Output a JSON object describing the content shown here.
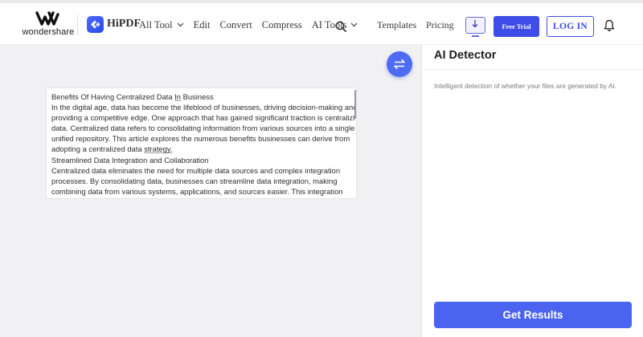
{
  "header": {
    "brand_text": "wondershare",
    "product_name": "HiPDF",
    "nav": [
      {
        "label": "All Tool",
        "has_dropdown": true
      },
      {
        "label": "Edit",
        "has_dropdown": false
      },
      {
        "label": "Convert",
        "has_dropdown": false
      },
      {
        "label": "Compress",
        "has_dropdown": false
      },
      {
        "label": "AI Tools",
        "has_dropdown": true
      }
    ],
    "templates_label": "Templates",
    "pricing_label": "Pricing",
    "free_trial_label": "Free Trial",
    "login_label": "LOG IN",
    "icons": {
      "search": "search-icon",
      "download": "download-icon",
      "bell": "bell-icon",
      "swap": "swap-arrows-icon"
    }
  },
  "document": {
    "lines": [
      [
        "Benefits Of Having Centralized Data ",
        {
          "u": "In"
        },
        " Business"
      ],
      [
        "In the digital age, data has become the lifeblood of businesses, driving decision-making and"
      ],
      [
        "providing a competitive edge. One approach that has gained significant traction is centralizing"
      ],
      [
        "data. Centralized data refers to consolidating information from various sources into a single,"
      ],
      [
        "unified repository. This article explores the numerous benefits businesses can derive from"
      ],
      [
        "adopting a centralized data ",
        {
          "u": "strategy."
        }
      ],
      [
        "Streamlined Data Integration and Collaboration"
      ],
      [
        "Centralized data eliminates the need for multiple data sources and complex integration"
      ],
      [
        "processes. By consolidating data, businesses can streamline data integration, making"
      ],
      [
        "combining data from various systems, applications, and sources easier. This integration"
      ]
    ]
  },
  "panel": {
    "title": "AI Detector",
    "description": "Intelligent detection of whether your files are generated by AI.",
    "button_label": "Get Results"
  },
  "colors": {
    "accent": "#4b64f0",
    "workspace_bg": "#f1f0f3",
    "brand_blue": "#3e4ce8"
  }
}
